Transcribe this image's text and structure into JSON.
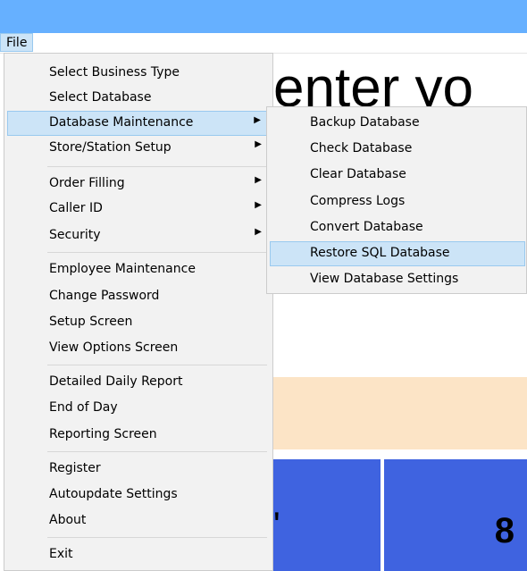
{
  "menubar": {
    "file_label": "File"
  },
  "background": {
    "title_fragment": "enter yo",
    "tile_left_text": "'",
    "tile_right_text": "8"
  },
  "file_menu": {
    "items": [
      {
        "label": "Select Business Type"
      },
      {
        "label": "Select Database"
      },
      {
        "label": "Database Maintenance",
        "submenu": true,
        "highlighted": true
      },
      {
        "label": "Store/Station Setup",
        "submenu": true
      },
      {
        "label": "Order Filling",
        "submenu": true
      },
      {
        "label": "Caller ID",
        "submenu": true
      },
      {
        "label": "Security",
        "submenu": true
      },
      {
        "label": "Employee Maintenance"
      },
      {
        "label": "Change Password"
      },
      {
        "label": "Setup Screen"
      },
      {
        "label": "View Options Screen"
      },
      {
        "label": "Detailed Daily Report"
      },
      {
        "label": "End of Day"
      },
      {
        "label": "Reporting Screen"
      },
      {
        "label": "Register"
      },
      {
        "label": "Autoupdate Settings"
      },
      {
        "label": "About"
      },
      {
        "label": "Exit"
      }
    ]
  },
  "database_maintenance_submenu": {
    "items": [
      {
        "label": "Backup Database"
      },
      {
        "label": "Check Database"
      },
      {
        "label": "Clear Database"
      },
      {
        "label": "Compress Logs"
      },
      {
        "label": "Convert Database"
      },
      {
        "label": "Restore SQL Database",
        "highlighted": true
      },
      {
        "label": "View Database Settings"
      }
    ]
  },
  "colors": {
    "titlebar": "#66b0ff",
    "highlight": "#cce4f7",
    "highlight_border": "#99c9ef",
    "tile": "#3f63e0",
    "band": "#fce4c6"
  },
  "icons": {
    "submenu_arrow": "right-triangle-icon"
  }
}
